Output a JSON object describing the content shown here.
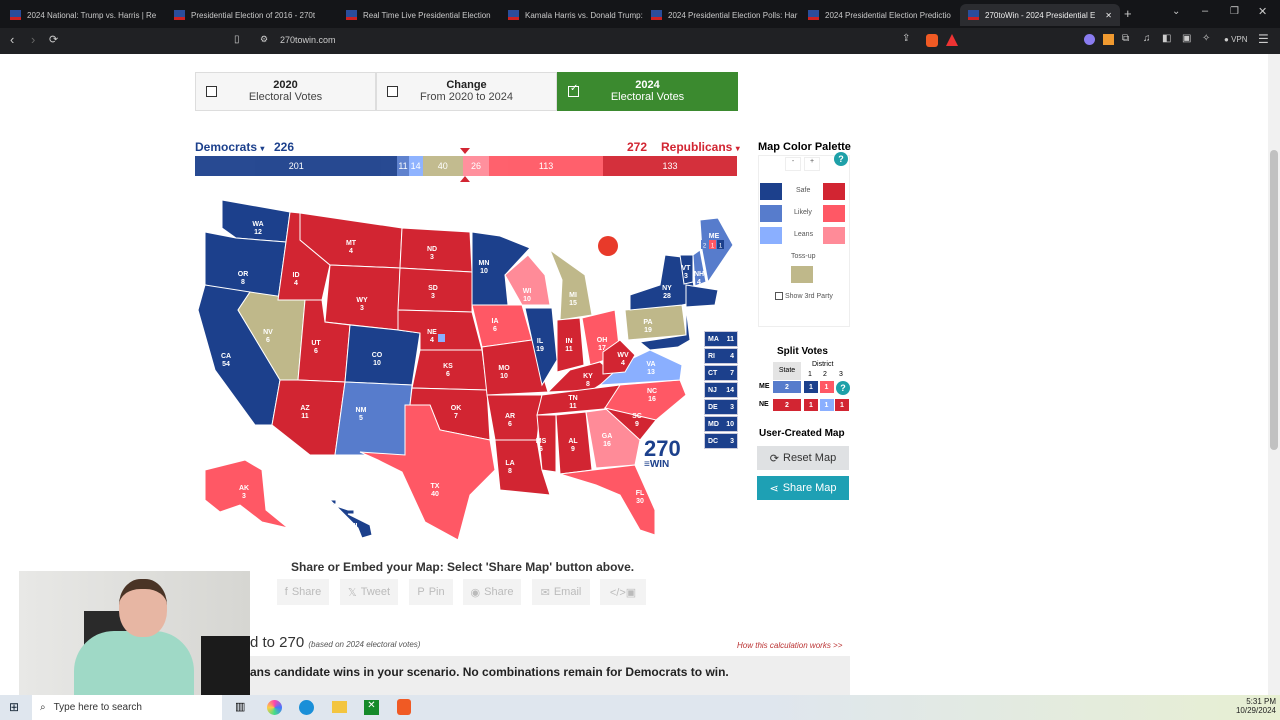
{
  "browser": {
    "tabs": [
      "2024 National: Trump vs. Harris | Re",
      "Presidential Election of 2016 - 270t",
      "Real Time Live Presidential Election",
      "Kamala Harris vs. Donald Trump: La",
      "2024 Presidential Election Polls: Har",
      "2024 Presidential Election Predictio",
      "270toWin - 2024 Presidential E"
    ],
    "active_tab": 6,
    "url": "270towin.com",
    "vpn_label": "VPN"
  },
  "toggles": [
    {
      "title": "2020",
      "sub": "Electoral Votes",
      "checked": false
    },
    {
      "title": "Change",
      "sub": "From 2020 to 2024",
      "checked": false
    },
    {
      "title": "2024",
      "sub": "Electoral Votes",
      "checked": true
    }
  ],
  "tally": {
    "dem_label": "Democrats",
    "dem_total": "226",
    "rep_total": "272",
    "rep_label": "Republicans"
  },
  "colors": {
    "safe_d": "#1c408c",
    "likely_d": "#577ccc",
    "lean_d": "#8aafff",
    "tossup": "#bfb88a",
    "lean_r": "#ff8b98",
    "likely_r": "#ff5865",
    "safe_r": "#d22532"
  },
  "bar": [
    {
      "cat": "safe_d",
      "value": 201
    },
    {
      "cat": "likely_d",
      "value": 11
    },
    {
      "cat": "lean_d",
      "value": 14
    },
    {
      "cat": "tossup",
      "value": 40
    },
    {
      "cat": "lean_r",
      "value": 26
    },
    {
      "cat": "likely_r",
      "value": 113
    },
    {
      "cat": "safe_r",
      "value": 133
    }
  ],
  "states": [
    {
      "abbr": "WA",
      "ev": "12",
      "cat": "safe_d"
    },
    {
      "abbr": "OR",
      "ev": "8",
      "cat": "safe_d"
    },
    {
      "abbr": "CA",
      "ev": "54",
      "cat": "safe_d"
    },
    {
      "abbr": "NV",
      "ev": "6",
      "cat": "tossup"
    },
    {
      "abbr": "ID",
      "ev": "4",
      "cat": "safe_r"
    },
    {
      "abbr": "MT",
      "ev": "4",
      "cat": "safe_r"
    },
    {
      "abbr": "WY",
      "ev": "3",
      "cat": "safe_r"
    },
    {
      "abbr": "UT",
      "ev": "6",
      "cat": "safe_r"
    },
    {
      "abbr": "AZ",
      "ev": "11",
      "cat": "safe_r"
    },
    {
      "abbr": "CO",
      "ev": "10",
      "cat": "safe_d"
    },
    {
      "abbr": "NM",
      "ev": "5",
      "cat": "likely_d"
    },
    {
      "abbr": "ND",
      "ev": "3",
      "cat": "safe_r"
    },
    {
      "abbr": "SD",
      "ev": "3",
      "cat": "safe_r"
    },
    {
      "abbr": "NE",
      "ev": "4",
      "cat": "safe_r"
    },
    {
      "abbr": "KS",
      "ev": "6",
      "cat": "safe_r"
    },
    {
      "abbr": "OK",
      "ev": "7",
      "cat": "safe_r"
    },
    {
      "abbr": "TX",
      "ev": "40",
      "cat": "likely_r"
    },
    {
      "abbr": "MN",
      "ev": "10",
      "cat": "safe_d"
    },
    {
      "abbr": "IA",
      "ev": "6",
      "cat": "likely_r"
    },
    {
      "abbr": "MO",
      "ev": "10",
      "cat": "safe_r"
    },
    {
      "abbr": "AR",
      "ev": "6",
      "cat": "safe_r"
    },
    {
      "abbr": "LA",
      "ev": "8",
      "cat": "safe_r"
    },
    {
      "abbr": "WI",
      "ev": "10",
      "cat": "lean_r"
    },
    {
      "abbr": "IL",
      "ev": "19",
      "cat": "safe_d"
    },
    {
      "abbr": "MI",
      "ev": "15",
      "cat": "tossup"
    },
    {
      "abbr": "IN",
      "ev": "11",
      "cat": "safe_r"
    },
    {
      "abbr": "OH",
      "ev": "17",
      "cat": "likely_r"
    },
    {
      "abbr": "KY",
      "ev": "8",
      "cat": "safe_r"
    },
    {
      "abbr": "TN",
      "ev": "11",
      "cat": "safe_r"
    },
    {
      "abbr": "MS",
      "ev": "6",
      "cat": "safe_r"
    },
    {
      "abbr": "AL",
      "ev": "9",
      "cat": "safe_r"
    },
    {
      "abbr": "GA",
      "ev": "16",
      "cat": "lean_r"
    },
    {
      "abbr": "FL",
      "ev": "30",
      "cat": "likely_r"
    },
    {
      "abbr": "SC",
      "ev": "9",
      "cat": "safe_r"
    },
    {
      "abbr": "NC",
      "ev": "16",
      "cat": "likely_r"
    },
    {
      "abbr": "VA",
      "ev": "13",
      "cat": "lean_d"
    },
    {
      "abbr": "WV",
      "ev": "4",
      "cat": "safe_r"
    },
    {
      "abbr": "PA",
      "ev": "19",
      "cat": "tossup"
    },
    {
      "abbr": "NY",
      "ev": "28",
      "cat": "safe_d"
    },
    {
      "abbr": "VT",
      "ev": "3",
      "cat": "safe_d"
    },
    {
      "abbr": "NH",
      "ev": "4",
      "cat": "likely_d"
    },
    {
      "abbr": "ME",
      "ev": "2",
      "cat": "likely_d"
    },
    {
      "abbr": "NE_EAST",
      "ev": "",
      "cat": "safe_d"
    },
    {
      "abbr": "AK",
      "ev": "3",
      "cat": "likely_r"
    },
    {
      "abbr": "HI",
      "ev": "4",
      "cat": "safe_d"
    }
  ],
  "east_boxes": [
    {
      "abbr": "MA",
      "ev": "11"
    },
    {
      "abbr": "RI",
      "ev": "4"
    },
    {
      "abbr": "CT",
      "ev": "7"
    },
    {
      "abbr": "NJ",
      "ev": "14"
    },
    {
      "abbr": "DE",
      "ev": "3"
    },
    {
      "abbr": "MD",
      "ev": "10"
    },
    {
      "abbr": "DC",
      "ev": "3"
    }
  ],
  "logo": "270toWIN",
  "palette": {
    "title": "Map Color Palette",
    "minus": "-",
    "plus": "+",
    "help": "?",
    "safe": "Safe",
    "likely": "Likely",
    "leans": "Leans",
    "tossup": "Toss-up",
    "third_party": "Show 3rd Party"
  },
  "split_votes": {
    "title": "Split Votes",
    "state_header": "State",
    "district_header": "District",
    "districts": [
      "1",
      "2",
      "3"
    ],
    "rows": [
      {
        "state": "ME",
        "total": "2",
        "total_cat": "likely_d",
        "d": [
          {
            "v": "1",
            "cat": "safe_d"
          },
          {
            "v": "1",
            "cat": "likely_r"
          }
        ]
      },
      {
        "state": "NE",
        "total": "2",
        "total_cat": "safe_r",
        "d": [
          {
            "v": "1",
            "cat": "safe_r"
          },
          {
            "v": "1",
            "cat": "lean_d"
          },
          {
            "v": "1",
            "cat": "safe_r"
          }
        ]
      }
    ],
    "me_map": [
      "2",
      "1",
      "1"
    ]
  },
  "user_map": {
    "title": "User-Created Map",
    "reset": "Reset Map",
    "share": "Share Map"
  },
  "embed": {
    "text": "Share or Embed your Map: Select 'Share Map' button above.",
    "buttons": [
      "Share",
      "Tweet",
      "Pin",
      "Share",
      "Email",
      ""
    ]
  },
  "road": {
    "title": "d to 270",
    "note": "(based on 2024 electoral votes)",
    "link": "How this calculation works >>",
    "result": "ans candidate wins in your scenario. No combinations remain for Democrats to win."
  },
  "taskbar": {
    "search_placeholder": "Type here to search",
    "time": "5:31 PM",
    "date": "10/29/2024"
  }
}
